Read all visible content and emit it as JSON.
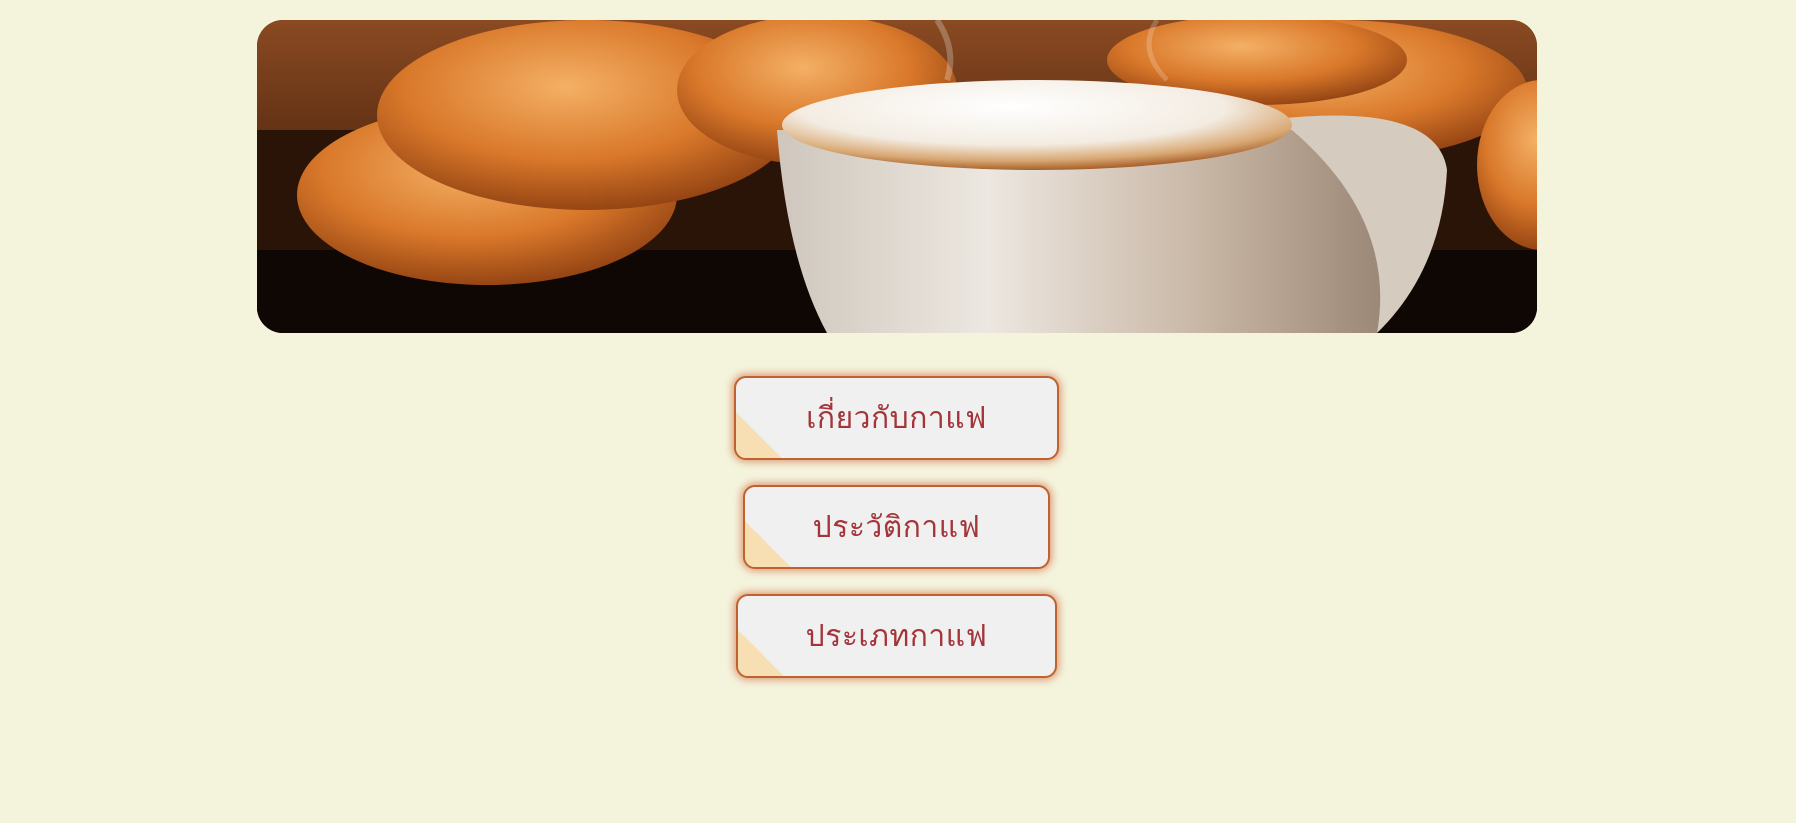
{
  "colors": {
    "background": "#f4f4dc",
    "button_border": "#c0622e",
    "button_fill": "#f0f0f0",
    "button_text": "#a3353a",
    "button_corner": "#f7dfb3"
  },
  "hero": {
    "image": "coffee-and-croissants-banner"
  },
  "menu": {
    "items": [
      {
        "label": "เกี่ยวกับกาแฟ"
      },
      {
        "label": "ประวัติกาแฟ"
      },
      {
        "label": "ประเภทกาแฟ"
      }
    ]
  }
}
